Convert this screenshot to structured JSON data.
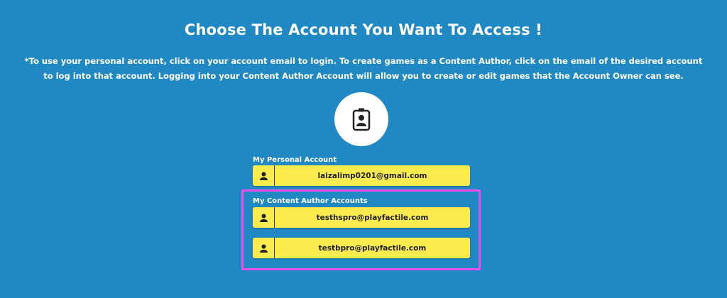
{
  "header": {
    "title": "Choose The Account You Want To Access !",
    "note": "*To use your personal account, click on your account email to login. To create games as a Content Author, click on the email of the desired account to log into that account. Logging into your Content Author Account will allow you to create or edit games that the Account Owner can see."
  },
  "badge": {
    "icon": "id-badge-icon"
  },
  "personal": {
    "label": "My Personal Account",
    "email": "laizalimp0201@gmail.com"
  },
  "content_author": {
    "label": "My Content Author Accounts",
    "accounts": [
      {
        "email": "testhspro@playfactile.com"
      },
      {
        "email": "testbpro@playfactile.com"
      }
    ]
  },
  "colors": {
    "background": "#2089c4",
    "button": "#fbeb4f",
    "highlight": "#ec4ff0"
  }
}
